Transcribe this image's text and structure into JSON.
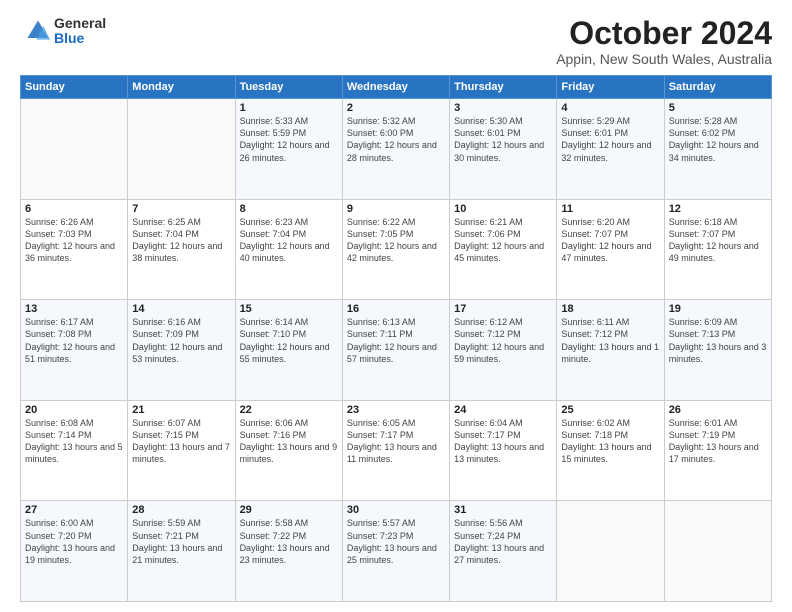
{
  "logo": {
    "general": "General",
    "blue": "Blue"
  },
  "title": "October 2024",
  "location": "Appin, New South Wales, Australia",
  "days_of_week": [
    "Sunday",
    "Monday",
    "Tuesday",
    "Wednesday",
    "Thursday",
    "Friday",
    "Saturday"
  ],
  "weeks": [
    [
      {
        "day": "",
        "info": ""
      },
      {
        "day": "",
        "info": ""
      },
      {
        "day": "1",
        "info": "Sunrise: 5:33 AM\nSunset: 5:59 PM\nDaylight: 12 hours\nand 26 minutes."
      },
      {
        "day": "2",
        "info": "Sunrise: 5:32 AM\nSunset: 6:00 PM\nDaylight: 12 hours\nand 28 minutes."
      },
      {
        "day": "3",
        "info": "Sunrise: 5:30 AM\nSunset: 6:01 PM\nDaylight: 12 hours\nand 30 minutes."
      },
      {
        "day": "4",
        "info": "Sunrise: 5:29 AM\nSunset: 6:01 PM\nDaylight: 12 hours\nand 32 minutes."
      },
      {
        "day": "5",
        "info": "Sunrise: 5:28 AM\nSunset: 6:02 PM\nDaylight: 12 hours\nand 34 minutes."
      }
    ],
    [
      {
        "day": "6",
        "info": "Sunrise: 6:26 AM\nSunset: 7:03 PM\nDaylight: 12 hours\nand 36 minutes."
      },
      {
        "day": "7",
        "info": "Sunrise: 6:25 AM\nSunset: 7:04 PM\nDaylight: 12 hours\nand 38 minutes."
      },
      {
        "day": "8",
        "info": "Sunrise: 6:23 AM\nSunset: 7:04 PM\nDaylight: 12 hours\nand 40 minutes."
      },
      {
        "day": "9",
        "info": "Sunrise: 6:22 AM\nSunset: 7:05 PM\nDaylight: 12 hours\nand 42 minutes."
      },
      {
        "day": "10",
        "info": "Sunrise: 6:21 AM\nSunset: 7:06 PM\nDaylight: 12 hours\nand 45 minutes."
      },
      {
        "day": "11",
        "info": "Sunrise: 6:20 AM\nSunset: 7:07 PM\nDaylight: 12 hours\nand 47 minutes."
      },
      {
        "day": "12",
        "info": "Sunrise: 6:18 AM\nSunset: 7:07 PM\nDaylight: 12 hours\nand 49 minutes."
      }
    ],
    [
      {
        "day": "13",
        "info": "Sunrise: 6:17 AM\nSunset: 7:08 PM\nDaylight: 12 hours\nand 51 minutes."
      },
      {
        "day": "14",
        "info": "Sunrise: 6:16 AM\nSunset: 7:09 PM\nDaylight: 12 hours\nand 53 minutes."
      },
      {
        "day": "15",
        "info": "Sunrise: 6:14 AM\nSunset: 7:10 PM\nDaylight: 12 hours\nand 55 minutes."
      },
      {
        "day": "16",
        "info": "Sunrise: 6:13 AM\nSunset: 7:11 PM\nDaylight: 12 hours\nand 57 minutes."
      },
      {
        "day": "17",
        "info": "Sunrise: 6:12 AM\nSunset: 7:12 PM\nDaylight: 12 hours\nand 59 minutes."
      },
      {
        "day": "18",
        "info": "Sunrise: 6:11 AM\nSunset: 7:12 PM\nDaylight: 13 hours\nand 1 minute."
      },
      {
        "day": "19",
        "info": "Sunrise: 6:09 AM\nSunset: 7:13 PM\nDaylight: 13 hours\nand 3 minutes."
      }
    ],
    [
      {
        "day": "20",
        "info": "Sunrise: 6:08 AM\nSunset: 7:14 PM\nDaylight: 13 hours\nand 5 minutes."
      },
      {
        "day": "21",
        "info": "Sunrise: 6:07 AM\nSunset: 7:15 PM\nDaylight: 13 hours\nand 7 minutes."
      },
      {
        "day": "22",
        "info": "Sunrise: 6:06 AM\nSunset: 7:16 PM\nDaylight: 13 hours\nand 9 minutes."
      },
      {
        "day": "23",
        "info": "Sunrise: 6:05 AM\nSunset: 7:17 PM\nDaylight: 13 hours\nand 11 minutes."
      },
      {
        "day": "24",
        "info": "Sunrise: 6:04 AM\nSunset: 7:17 PM\nDaylight: 13 hours\nand 13 minutes."
      },
      {
        "day": "25",
        "info": "Sunrise: 6:02 AM\nSunset: 7:18 PM\nDaylight: 13 hours\nand 15 minutes."
      },
      {
        "day": "26",
        "info": "Sunrise: 6:01 AM\nSunset: 7:19 PM\nDaylight: 13 hours\nand 17 minutes."
      }
    ],
    [
      {
        "day": "27",
        "info": "Sunrise: 6:00 AM\nSunset: 7:20 PM\nDaylight: 13 hours\nand 19 minutes."
      },
      {
        "day": "28",
        "info": "Sunrise: 5:59 AM\nSunset: 7:21 PM\nDaylight: 13 hours\nand 21 minutes."
      },
      {
        "day": "29",
        "info": "Sunrise: 5:58 AM\nSunset: 7:22 PM\nDaylight: 13 hours\nand 23 minutes."
      },
      {
        "day": "30",
        "info": "Sunrise: 5:57 AM\nSunset: 7:23 PM\nDaylight: 13 hours\nand 25 minutes."
      },
      {
        "day": "31",
        "info": "Sunrise: 5:56 AM\nSunset: 7:24 PM\nDaylight: 13 hours\nand 27 minutes."
      },
      {
        "day": "",
        "info": ""
      },
      {
        "day": "",
        "info": ""
      }
    ]
  ]
}
